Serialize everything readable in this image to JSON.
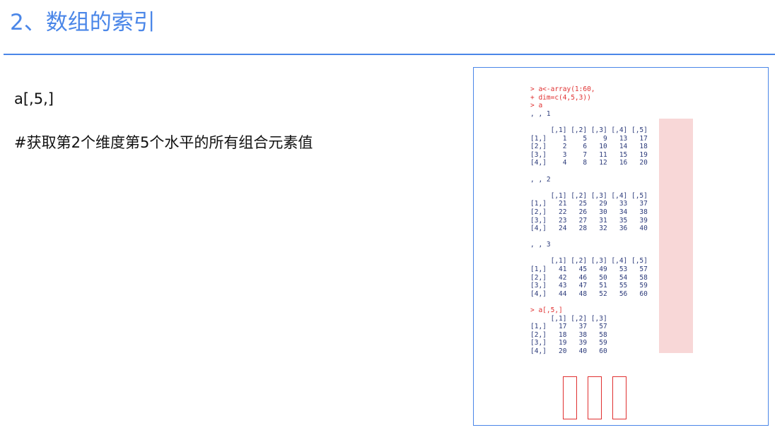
{
  "slide": {
    "title": "2、数组的索引",
    "line1": "a[,5,]",
    "line2": "#获取第2个维度第5个水平的所有组合元素值"
  },
  "console": {
    "lines": [
      {
        "text": "> a<-array(1:60,",
        "kind": "cmd"
      },
      {
        "text": "+ dim=c(4,5,3))",
        "kind": "cmd"
      },
      {
        "text": "> a",
        "kind": "cmd"
      },
      {
        "text": ", , 1",
        "kind": "out"
      },
      {
        "text": "",
        "kind": "out"
      },
      {
        "text": "     [,1] [,2] [,3] [,4] [,5]",
        "kind": "out"
      },
      {
        "text": "[1,]    1    5    9   13   17",
        "kind": "out"
      },
      {
        "text": "[2,]    2    6   10   14   18",
        "kind": "out"
      },
      {
        "text": "[3,]    3    7   11   15   19",
        "kind": "out"
      },
      {
        "text": "[4,]    4    8   12   16   20",
        "kind": "out"
      },
      {
        "text": "",
        "kind": "out"
      },
      {
        "text": ", , 2",
        "kind": "out"
      },
      {
        "text": "",
        "kind": "out"
      },
      {
        "text": "     [,1] [,2] [,3] [,4] [,5]",
        "kind": "out"
      },
      {
        "text": "[1,]   21   25   29   33   37",
        "kind": "out"
      },
      {
        "text": "[2,]   22   26   30   34   38",
        "kind": "out"
      },
      {
        "text": "[3,]   23   27   31   35   39",
        "kind": "out"
      },
      {
        "text": "[4,]   24   28   32   36   40",
        "kind": "out"
      },
      {
        "text": "",
        "kind": "out"
      },
      {
        "text": ", , 3",
        "kind": "out"
      },
      {
        "text": "",
        "kind": "out"
      },
      {
        "text": "     [,1] [,2] [,3] [,4] [,5]",
        "kind": "out"
      },
      {
        "text": "[1,]   41   45   49   53   57",
        "kind": "out"
      },
      {
        "text": "[2,]   42   46   50   54   58",
        "kind": "out"
      },
      {
        "text": "[3,]   43   47   51   55   59",
        "kind": "out"
      },
      {
        "text": "[4,]   44   48   52   56   60",
        "kind": "out"
      },
      {
        "text": "",
        "kind": "out"
      },
      {
        "text": "> a[,5,]",
        "kind": "cmd"
      },
      {
        "text": "     [,1] [,2] [,3]",
        "kind": "out"
      },
      {
        "text": "[1,]   17   37   57",
        "kind": "out"
      },
      {
        "text": "[2,]   18   38   58",
        "kind": "out"
      },
      {
        "text": "[3,]   19   39   59",
        "kind": "out"
      },
      {
        "text": "[4,]   20   40   60",
        "kind": "out"
      }
    ],
    "highlight_color": "#f8d7d7",
    "box_color": "#e03030"
  },
  "colors": {
    "title": "#4a86e8",
    "command": "#e03030",
    "output": "#2b3a7a"
  }
}
